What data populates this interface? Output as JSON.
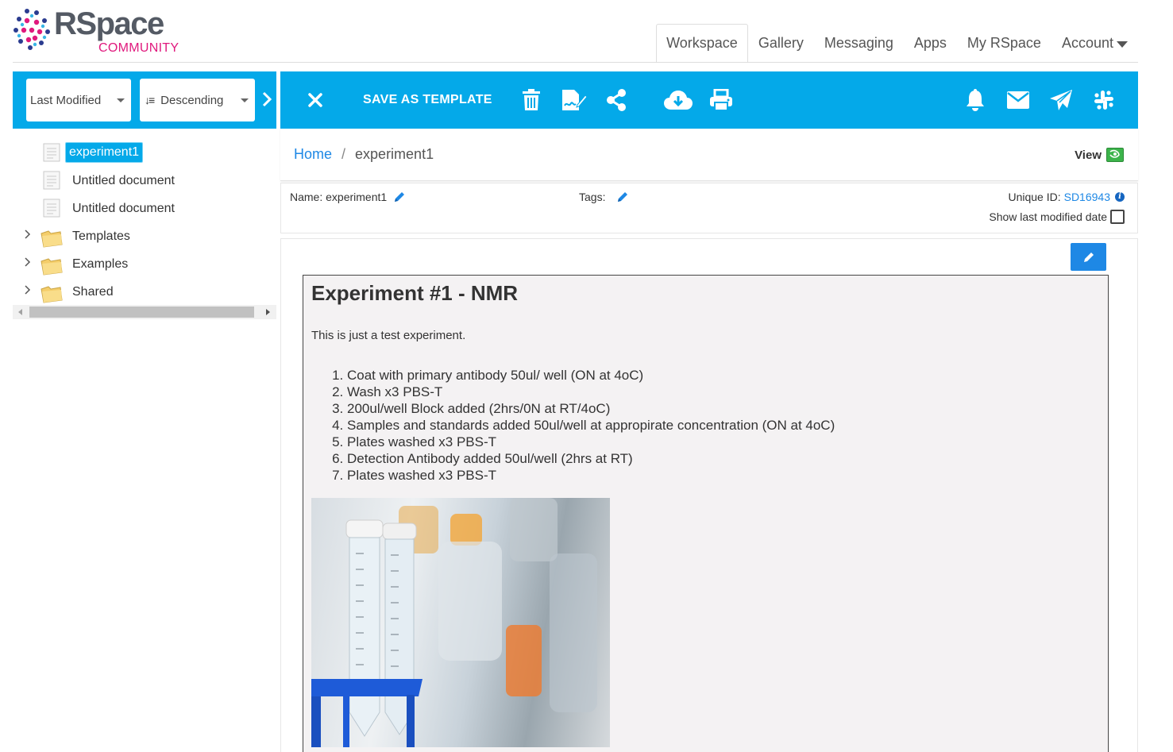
{
  "app": {
    "logo_main": "RSpace",
    "logo_sub": "COMMUNITY"
  },
  "topnav": {
    "tabs": [
      {
        "label": "Workspace",
        "active": true
      },
      {
        "label": "Gallery"
      },
      {
        "label": "Messaging"
      },
      {
        "label": "Apps"
      },
      {
        "label": "My RSpace"
      },
      {
        "label": "Account"
      }
    ]
  },
  "sorting": {
    "order_by": "Last Modified",
    "direction": "Descending"
  },
  "tree": {
    "items": [
      {
        "label": "experiment1",
        "type": "document",
        "selected": true
      },
      {
        "label": "Untitled document",
        "type": "document"
      },
      {
        "label": "Untitled document",
        "type": "document"
      },
      {
        "label": "Templates",
        "type": "folder"
      },
      {
        "label": "Examples",
        "type": "folder"
      },
      {
        "label": "Shared",
        "type": "folder"
      }
    ]
  },
  "toolbar": {
    "save_as_template": "SAVE AS TEMPLATE",
    "icons": [
      "close-icon",
      "trash-icon",
      "sign-icon",
      "share-icon",
      "cloud-download-icon",
      "print-icon",
      "bell-icon",
      "envelope-icon",
      "paper-plane-icon",
      "slack-icon"
    ]
  },
  "breadcrumb": {
    "home": "Home",
    "separator": "/",
    "current": "experiment1"
  },
  "view": {
    "label": "View"
  },
  "meta": {
    "name_label": "Name: experiment1",
    "tags_label": "Tags:",
    "uid_label": "Unique ID:",
    "uid_value": "SD16943",
    "show_last_modified": "Show last modified date"
  },
  "document": {
    "title": "Experiment #1 - NMR",
    "intro": "This is just a test experiment.",
    "steps": [
      "Coat with primary antibody 50ul/ well (ON at 4oC)",
      "Wash x3 PBS-T",
      "200ul/well Block added (2hrs/0N at RT/4oC)",
      "Samples and standards added 50ul/well at appropirate concentration (ON at 4oC)",
      "Plates washed x3 PBS-T",
      "Detection Antibody added 50ul/well (2hrs at RT)",
      "Plates washed x3 PBS-T"
    ]
  },
  "colors": {
    "brand_blue": "#04a9e9",
    "link_blue": "#1e88e5",
    "logo_pink": "#e0197d",
    "selection": "#04a9e9"
  }
}
